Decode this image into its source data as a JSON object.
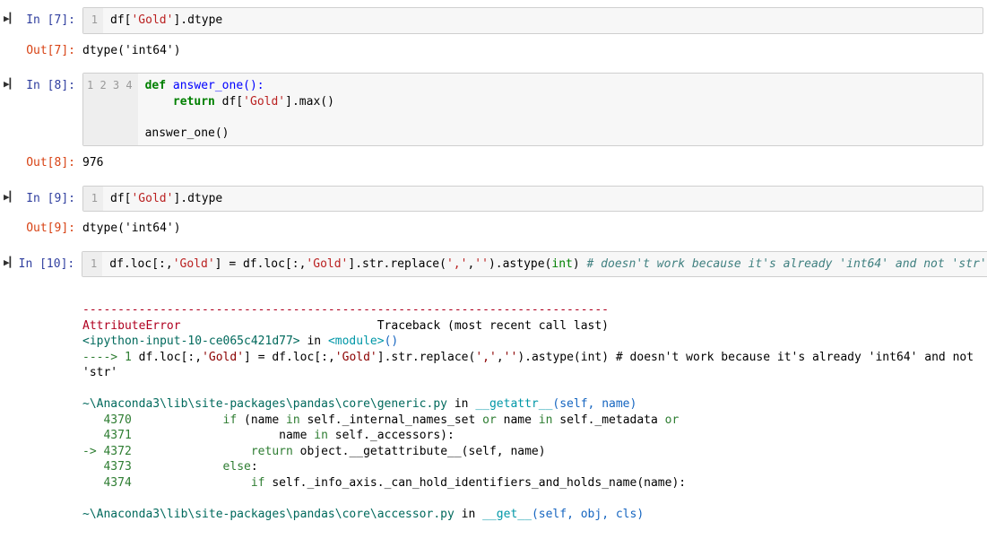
{
  "cells": {
    "c7": {
      "run_icon": "▶▎",
      "prompt_in": "In [7]:",
      "gutter": "1",
      "code_pre": "df[",
      "code_str": "'Gold'",
      "code_post": "].dtype",
      "prompt_out": "Out[7]:",
      "output": "dtype('int64')"
    },
    "c8": {
      "run_icon": "▶▎",
      "prompt_in": "In [8]:",
      "gutter": "1\n2\n3\n4",
      "l1_kw1": "def",
      "l1_name": " answer_one():",
      "l2_indent": "    ",
      "l2_kw": "return",
      "l2_mid": " df[",
      "l2_str": "'Gold'",
      "l2_post": "].max()",
      "l3": "",
      "l4": "answer_one()",
      "prompt_out": "Out[8]:",
      "output": "976"
    },
    "c9": {
      "run_icon": "▶▎",
      "prompt_in": "In [9]:",
      "gutter": "1",
      "code_pre": "df[",
      "code_str": "'Gold'",
      "code_post": "].dtype",
      "prompt_out": "Out[9]:",
      "output": "dtype('int64')"
    },
    "c10": {
      "run_icon": "▶▎",
      "prompt_in": "In [10]:",
      "gutter": "1",
      "code_1": "df.loc[:,",
      "code_s1": "'Gold'",
      "code_2": "] = df.loc[:,",
      "code_s2": "'Gold'",
      "code_3": "].str.replace(",
      "code_s3": "','",
      "code_4": ",",
      "code_s4": "''",
      "code_5": ").astype(",
      "code_b1": "int",
      "code_6": ") ",
      "code_comment": "# doesn't work because it's already 'int64' and not 'str'"
    }
  },
  "tb": {
    "dash": "---------------------------------------------------------------------------",
    "errname": "AttributeError",
    "tbhead": "                            Traceback (most recent call last)",
    "inputloc_pre": "<ipython-input-10-ce065c421d77>",
    "inputloc_in": " in ",
    "inputloc_mod": "<module>",
    "inputloc_post": "()",
    "arrow1": "----> 1 ",
    "line1_a": "df.loc[:,",
    "line1_s1": "'Gold'",
    "line1_b": "] = df.loc[:,",
    "line1_s2": "'Gold'",
    "line1_c": "].str.replace(",
    "line1_s3": "','",
    "line1_d": ",",
    "line1_s4": "''",
    "line1_e": ").astype(int) # doesn't work because it's already 'int64' and not 'str'",
    "file1_pre": "~\\Anaconda3\\lib\\site-packages\\pandas\\core\\generic.py",
    "file1_in": " in ",
    "file1_fn": "__getattr__",
    "file1_args": "(self, name)",
    "f1_4370": "   4370 ",
    "f1_4370_txt_a": "            ",
    "f1_4370_kw": "if",
    "f1_4370_txt_b": " (name ",
    "f1_4370_kw2": "in",
    "f1_4370_txt_c": " self._internal_names_set ",
    "f1_4370_kw3": "or",
    "f1_4370_txt_d": " name ",
    "f1_4370_kw4": "in",
    "f1_4370_txt_e": " self._metadata ",
    "f1_4370_kw5": "or",
    "f1_4371": "   4371 ",
    "f1_4371_txt_a": "                    name ",
    "f1_4371_kw": "in",
    "f1_4371_txt_b": " self._accessors):",
    "f1_arrow": "-> 4372 ",
    "f1_4372_txt_a": "                ",
    "f1_4372_kw": "return",
    "f1_4372_txt_b": " object.__getattribute__(self, name)",
    "f1_4373": "   4373 ",
    "f1_4373_txt_a": "            ",
    "f1_4373_kw": "else",
    "f1_4373_txt_b": ":",
    "f1_4374": "   4374 ",
    "f1_4374_txt_a": "                ",
    "f1_4374_kw": "if",
    "f1_4374_txt_b": " self._info_axis._can_hold_identifiers_and_holds_name(name):",
    "file2_pre": "~\\Anaconda3\\lib\\site-packages\\pandas\\core\\accessor.py",
    "file2_in": " in ",
    "file2_fn": "__get__",
    "file2_args": "(self, obj, cls)"
  }
}
